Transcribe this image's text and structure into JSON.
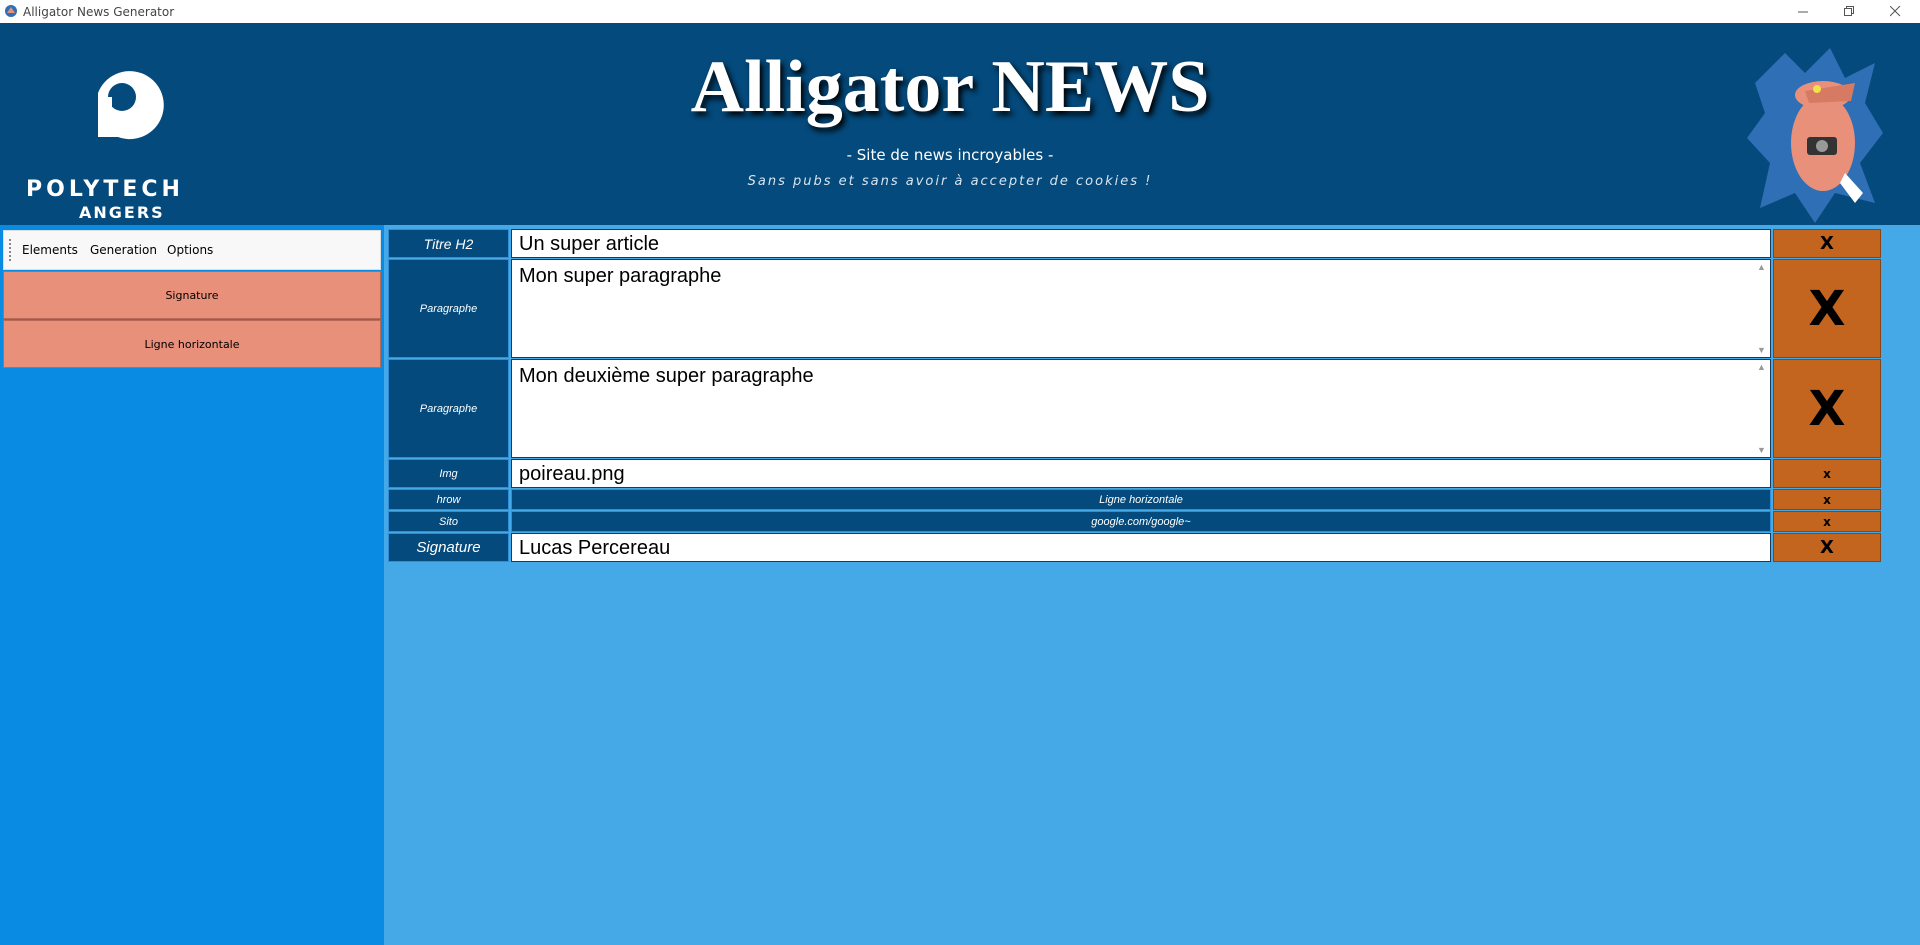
{
  "window": {
    "title": "Alligator News Generator",
    "minimize_icon": "minimize-icon",
    "restore_icon": "restore-icon",
    "close_icon": "close-icon"
  },
  "header": {
    "logo_line1": "POLYTECH",
    "logo_line2": "ANGERS",
    "title": "Alligator NEWS",
    "subtitle": "- Site de news incroyables -",
    "tagline": "Sans pubs et sans avoir à accepter de cookies !"
  },
  "menu": {
    "items": [
      "Elements",
      "Generation",
      "Options"
    ]
  },
  "left_buttons": [
    "Signature",
    "Ligne horizontale"
  ],
  "elements": [
    {
      "label": "Titre H2",
      "value": "Un super article",
      "delete": "X"
    },
    {
      "label": "Paragraphe",
      "value": "Mon super paragraphe",
      "delete": "X"
    },
    {
      "label": "Paragraphe",
      "value": "Mon deuxième super paragraphe",
      "delete": "X"
    },
    {
      "label": "Img",
      "value": "poireau.png",
      "delete": "x"
    },
    {
      "label": "hrow",
      "value": "Ligne horizontale",
      "delete": "x"
    },
    {
      "label": "Sito",
      "value": "google.com/google~",
      "delete": "x"
    },
    {
      "label": "Signature",
      "value": "Lucas Percereau",
      "delete": "X"
    }
  ],
  "colors": {
    "header_bg": "#044a7c",
    "left_panel_bg": "#0a8be3",
    "content_bg": "#45a9e8",
    "left_button_bg": "#e8907a",
    "delete_button_bg": "#c4651f"
  }
}
